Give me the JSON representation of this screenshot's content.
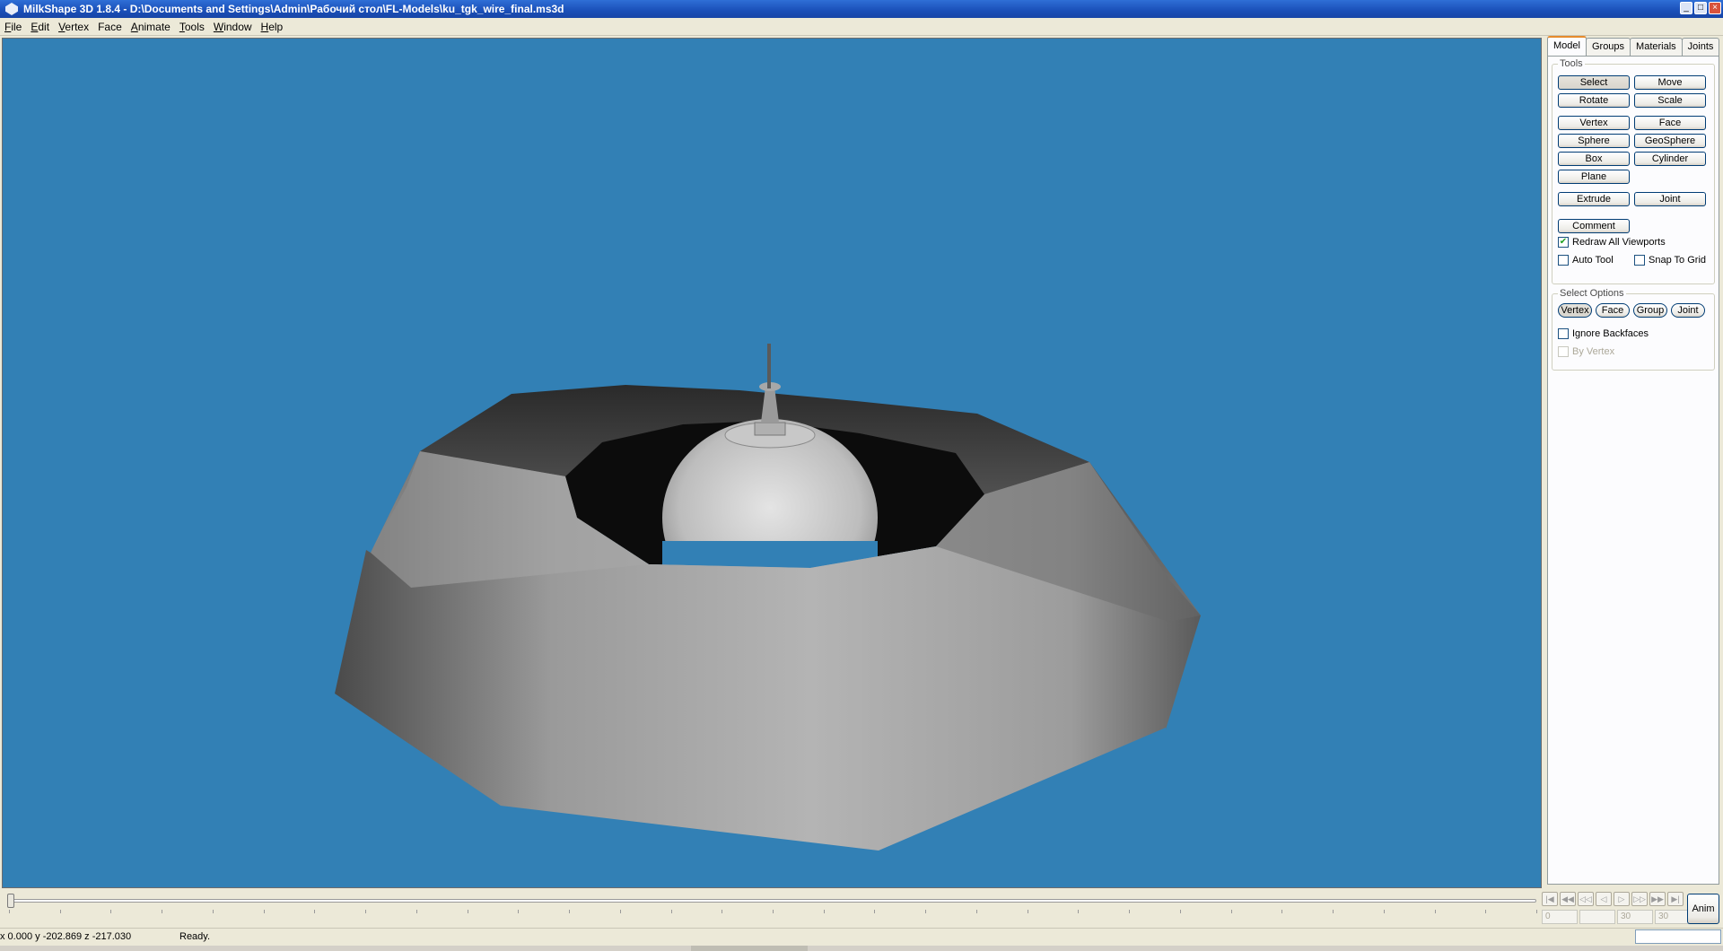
{
  "window": {
    "title": "MilkShape 3D 1.8.4 - D:\\Documents and Settings\\Admin\\Рабочий стол\\FL-Models\\ku_tgk_wire_final.ms3d",
    "minimize": "_",
    "maximize": "□",
    "close": "×"
  },
  "menu": [
    {
      "first": "F",
      "rest": "ile"
    },
    {
      "first": "E",
      "rest": "dit"
    },
    {
      "first": "V",
      "rest": "ertex"
    },
    {
      "first": "Fa",
      "rest": "ce"
    },
    {
      "first": "A",
      "rest": "nimate"
    },
    {
      "first": "T",
      "rest": "ools"
    },
    {
      "first": "W",
      "rest": "indow"
    },
    {
      "first": "H",
      "rest": "elp"
    }
  ],
  "viewport": {
    "background": "#3280b5"
  },
  "panel": {
    "tabs": [
      "Model",
      "Groups",
      "Materials",
      "Joints"
    ],
    "active_tab": "Model",
    "tools_legend": "Tools",
    "tools": {
      "select": "Select",
      "move": "Move",
      "rotate": "Rotate",
      "scale": "Scale",
      "vertex": "Vertex",
      "face": "Face",
      "sphere": "Sphere",
      "geosphere": "GeoSphere",
      "box": "Box",
      "cylinder": "Cylinder",
      "plane": "Plane",
      "extrude": "Extrude",
      "joint": "Joint",
      "comment": "Comment"
    },
    "redraw_all": {
      "label": "Redraw All Viewports",
      "checked": true
    },
    "auto_tool": {
      "label": "Auto Tool",
      "checked": false
    },
    "snap_to_grid": {
      "label": "Snap To Grid",
      "checked": false
    },
    "select_options_legend": "Select Options",
    "select_options": {
      "vertex": "Vertex",
      "face": "Face",
      "group": "Group",
      "joint": "Joint"
    },
    "ignore_backfaces": {
      "label": "Ignore Backfaces",
      "checked": false
    },
    "by_vertex": {
      "label": "By Vertex",
      "checked": false
    }
  },
  "timeline": {
    "frame_start": "0",
    "frame_current": "30",
    "frame_end": "30",
    "anim_label": "Anim"
  },
  "status": {
    "coords": "x 0.000 y -202.869 z -217.030",
    "message": "Ready."
  }
}
